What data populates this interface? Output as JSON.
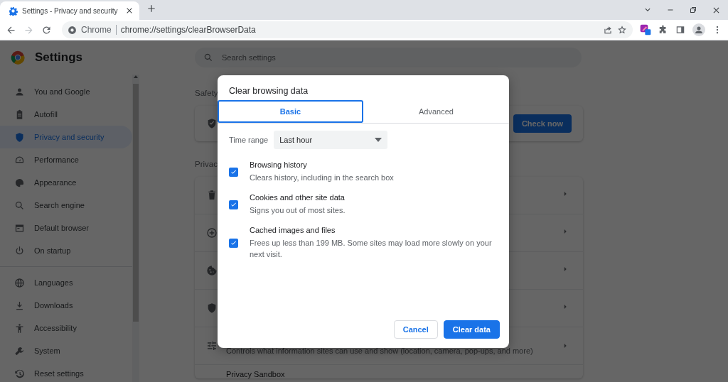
{
  "browser": {
    "tabs": [
      {
        "title": "Settings - Privacy and security",
        "selected": true
      }
    ],
    "omnibox": {
      "site_label": "Chrome",
      "url": "chrome://settings/clearBrowserData"
    }
  },
  "settings": {
    "title": "Settings",
    "search": {
      "placeholder": "Search settings"
    },
    "sidebar": {
      "groups": [
        {
          "items": [
            {
              "label": "You and Google",
              "selected": false
            },
            {
              "label": "Autofill",
              "selected": false
            },
            {
              "label": "Privacy and security",
              "selected": true
            },
            {
              "label": "Performance",
              "selected": false
            },
            {
              "label": "Appearance",
              "selected": false
            },
            {
              "label": "Search engine",
              "selected": false
            },
            {
              "label": "Default browser",
              "selected": false
            },
            {
              "label": "On startup",
              "selected": false
            }
          ]
        },
        {
          "items": [
            {
              "label": "Languages",
              "selected": false
            },
            {
              "label": "Downloads",
              "selected": false
            },
            {
              "label": "Accessibility",
              "selected": false
            },
            {
              "label": "System",
              "selected": false
            },
            {
              "label": "Reset settings",
              "selected": false
            }
          ]
        }
      ]
    },
    "safety": {
      "heading": "Safety",
      "button": "Check now"
    },
    "privacy": {
      "heading": "Privac",
      "rows": [
        {
          "kind": "plain"
        },
        {
          "kind": "plain"
        },
        {
          "kind": "plain"
        },
        {
          "kind": "plain"
        },
        {
          "kind": "described",
          "description": "Controls what information sites can use and show (location, camera, pop-ups, and more)"
        },
        {
          "kind": "titled",
          "title": "Privacy Sandbox"
        }
      ]
    }
  },
  "dialog": {
    "title": "Clear browsing data",
    "tabs": [
      {
        "label": "Basic",
        "selected": true
      },
      {
        "label": "Advanced",
        "selected": false
      }
    ],
    "time_range": {
      "label": "Time range",
      "value": "Last hour"
    },
    "options": [
      {
        "title": "Browsing history",
        "description": "Clears history, including in the search box",
        "checked": true
      },
      {
        "title": "Cookies and other site data",
        "description": "Signs you out of most sites.",
        "checked": true
      },
      {
        "title": "Cached images and files",
        "description": "Frees up less than 199 MB. Some sites may load more slowly on your next visit.",
        "checked": true
      }
    ],
    "buttons": [
      {
        "label": "Cancel",
        "kind": "secondary"
      },
      {
        "label": "Clear data",
        "kind": "primary"
      }
    ]
  }
}
